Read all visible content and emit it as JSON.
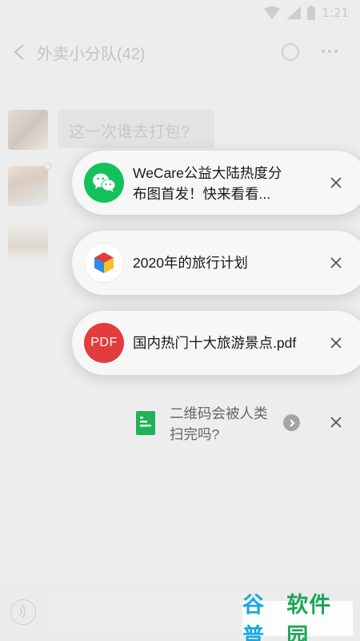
{
  "status_bar": {
    "time": "1:21"
  },
  "header": {
    "title": "外卖小分队(42)"
  },
  "chat": {
    "message": "这一次谁去打包?"
  },
  "cards": [
    {
      "icon": "wechat-icon",
      "title": "WeCare公益大陆热度分",
      "title2": "布图首发！快来看看..."
    },
    {
      "icon": "cube-app-icon",
      "title": "2020年的旅行计划"
    },
    {
      "icon": "pdf-icon",
      "icon_text": "PDF",
      "title": "国内热门十大旅游景点.pdf"
    }
  ],
  "doc_item": {
    "icon": "document-icon",
    "title": "二维码会被人类",
    "title2": "扫完吗?"
  },
  "watermark": {
    "part1": "谷普",
    "part2": "软件园"
  },
  "colors": {
    "wechat_green": "#15c15d",
    "pdf_red": "#e23c3c",
    "doc_green": "#1fb35b"
  }
}
